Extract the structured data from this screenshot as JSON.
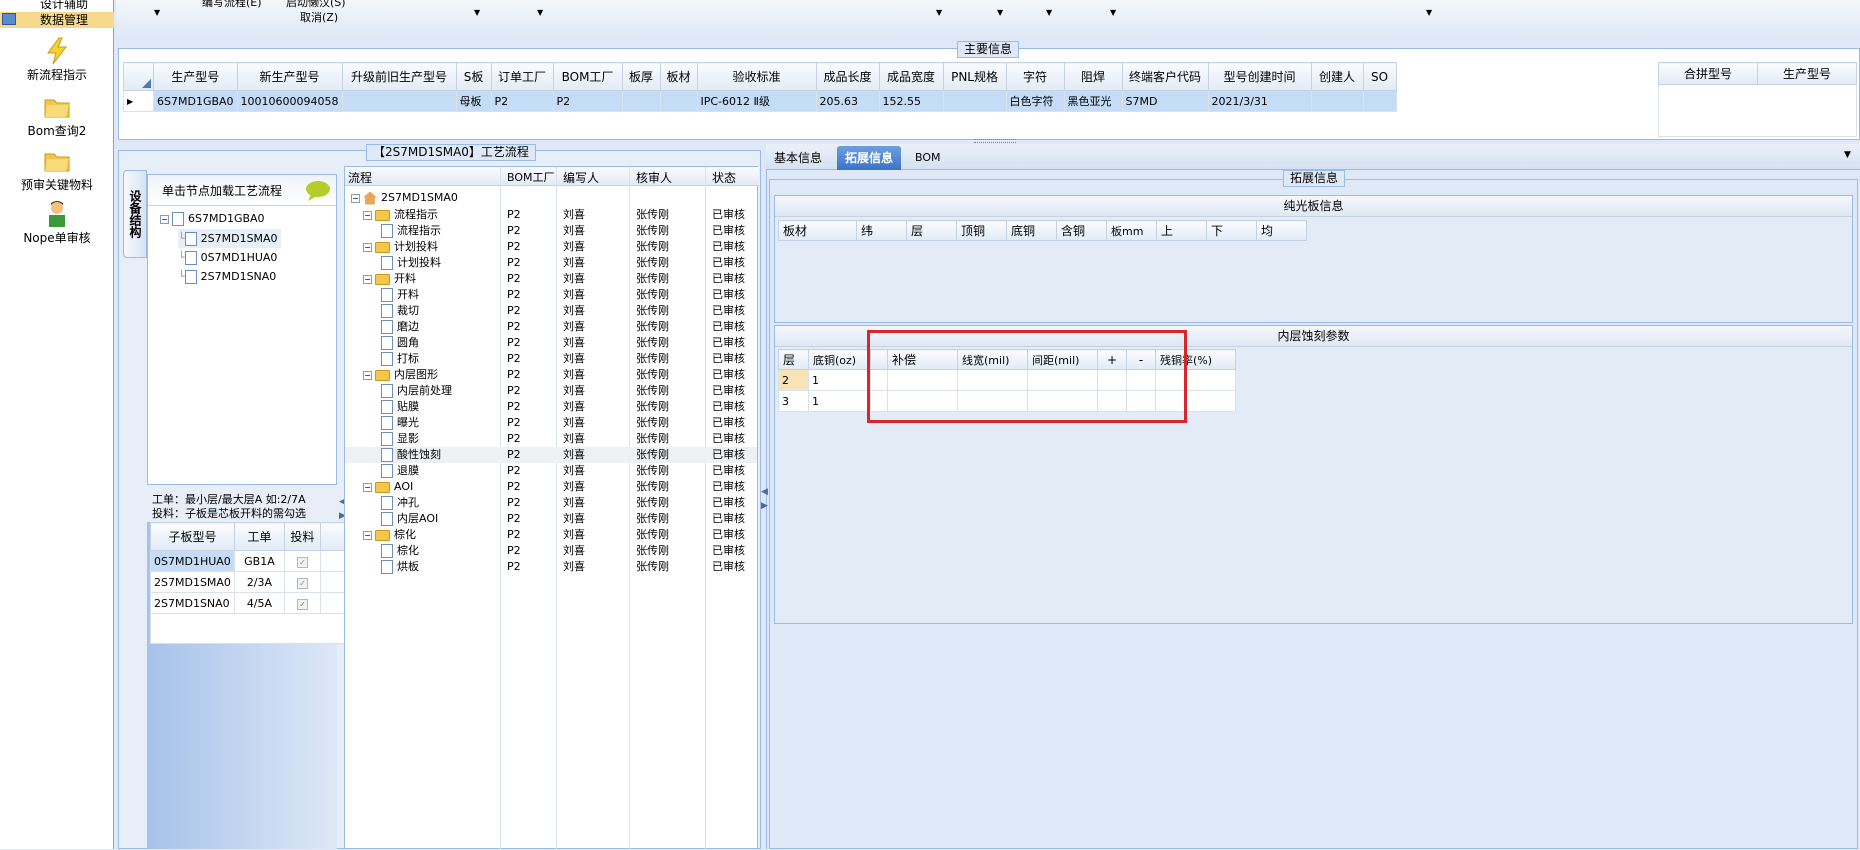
{
  "sidebar": {
    "top_items": [
      "设计辅助",
      "数据管理"
    ],
    "items": [
      {
        "label": "新流程指示",
        "icon": "lightning-icon"
      },
      {
        "label": "Bom查询2",
        "icon": "folder-icon"
      },
      {
        "label": "预审关键物料",
        "icon": "folder-icon"
      },
      {
        "label": "Nope单审核",
        "icon": "user-icon"
      }
    ]
  },
  "toolbar": {
    "items": [
      "编写流程(E)",
      "启动懒汉(S)",
      "取消(Z)"
    ]
  },
  "main_info": {
    "legend": "主要信息",
    "columns": [
      "生产型号",
      "新生产型号",
      "升级前旧生产型号",
      "S板",
      "订单工厂",
      "BOM工厂",
      "板厚",
      "板材",
      "验收标准",
      "成品长度",
      "成品宽度",
      "PNL规格",
      "字符",
      "阻焊",
      "终端客户代码",
      "型号创建时间",
      "创建人",
      "SO"
    ],
    "row": [
      "6S7MD1GBA0",
      "10010600094058",
      "",
      "母板",
      "P2",
      "P2",
      "",
      "",
      "IPC-6012 Ⅱ级",
      "205.63",
      "152.55",
      "",
      "白色字符",
      "黑色亚光",
      "S7MD",
      "2021/3/31",
      "",
      ""
    ],
    "right_columns": [
      "合拼型号",
      "生产型号"
    ]
  },
  "flow_panel": {
    "title": "【2S7MD1SMA0】工艺流程",
    "side_tab": "设备结构",
    "hint": "单击节点加载工艺流程",
    "tree_root": "6S7MD1GBA0",
    "tree_children": [
      "2S7MD1SMA0",
      "0S7MD1HUA0",
      "2S7MD1SNA0"
    ],
    "note_line1": "工单：最小层/最大层A 如:2/7A",
    "note_line2": "投料：子板是芯板开料的需勾选",
    "sub_columns": [
      "子板型号",
      "工单",
      "投料"
    ],
    "sub_rows": [
      {
        "model": "0S7MD1HUA0",
        "order": "GB1A"
      },
      {
        "model": "2S7MD1SMA0",
        "order": "2/3A"
      },
      {
        "model": "2S7MD1SNA0",
        "order": "4/5A"
      }
    ]
  },
  "process": {
    "columns": [
      "流程",
      "BOM工厂",
      "编写人",
      "核审人",
      "状态"
    ],
    "root": "2S7MD1SMA0",
    "rows": [
      {
        "name": "流程指示",
        "level": 1,
        "folder": true
      },
      {
        "name": "流程指示",
        "level": 2,
        "folder": false
      },
      {
        "name": "计划投料",
        "level": 1,
        "folder": true
      },
      {
        "name": "计划投料",
        "level": 2,
        "folder": false
      },
      {
        "name": "开料",
        "level": 1,
        "folder": true
      },
      {
        "name": "开料",
        "level": 2,
        "folder": false
      },
      {
        "name": "裁切",
        "level": 2,
        "folder": false
      },
      {
        "name": "磨边",
        "level": 2,
        "folder": false
      },
      {
        "name": "圆角",
        "level": 2,
        "folder": false
      },
      {
        "name": "打标",
        "level": 2,
        "folder": false
      },
      {
        "name": "内层图形",
        "level": 1,
        "folder": true
      },
      {
        "name": "内层前处理",
        "level": 2,
        "folder": false
      },
      {
        "name": "贴膜",
        "level": 2,
        "folder": false
      },
      {
        "name": "曝光",
        "level": 2,
        "folder": false
      },
      {
        "name": "显影",
        "level": 2,
        "folder": false
      },
      {
        "name": "酸性蚀刻",
        "level": 2,
        "folder": false
      },
      {
        "name": "退膜",
        "level": 2,
        "folder": false
      },
      {
        "name": "AOI",
        "level": 1,
        "folder": true
      },
      {
        "name": "冲孔",
        "level": 2,
        "folder": false
      },
      {
        "name": "内层AOI",
        "level": 2,
        "folder": false
      },
      {
        "name": "棕化",
        "level": 1,
        "folder": true
      },
      {
        "name": "棕化",
        "level": 2,
        "folder": false
      },
      {
        "name": "烘板",
        "level": 2,
        "folder": false
      }
    ],
    "bom": "P2",
    "writer": "刘喜",
    "reviewer": "张传刚",
    "status": "已审核"
  },
  "right_panel": {
    "tabs": [
      "基本信息",
      "拓展信息",
      "BOM"
    ],
    "legend": "拓展信息",
    "section1_title": "纯光板信息",
    "section1_columns": [
      "板材",
      "纬",
      "层",
      "顶铜",
      "底铜",
      "含铜",
      "板mm",
      "上",
      "下",
      "均"
    ],
    "section2_title": "内层蚀刻参数",
    "section2_columns": [
      "层",
      "底铜(oz)",
      "",
      "补偿",
      "线宽(mil)",
      "间距(mil)",
      "+",
      "-",
      "残铜率(%)"
    ],
    "section2_rows": [
      {
        "layer": "2",
        "base": "1"
      },
      {
        "layer": "3",
        "base": "1"
      }
    ],
    "highlight_color": "#d9262c"
  }
}
